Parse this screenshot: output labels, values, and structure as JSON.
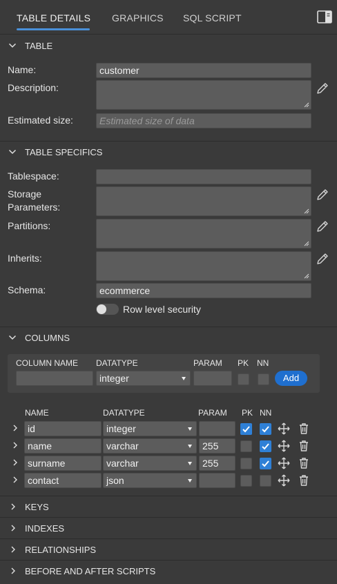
{
  "tabs": [
    {
      "label": "TABLE DETAILS",
      "active": true
    },
    {
      "label": "GRAPHICS",
      "active": false
    },
    {
      "label": "SQL SCRIPT",
      "active": false
    }
  ],
  "sections": {
    "table": "TABLE",
    "specifics": "TABLE SPECIFICS",
    "columns": "COLUMNS"
  },
  "table": {
    "name_label": "Name:",
    "name_value": "customer",
    "description_label": "Description:",
    "description_value": "",
    "size_label": "Estimated size:",
    "size_placeholder": "Estimated size of data"
  },
  "specifics": {
    "tablespace_label": "Tablespace:",
    "storage_label_1": "Storage",
    "storage_label_2": "Parameters:",
    "partitions_label": "Partitions:",
    "inherits_label": "Inherits:",
    "schema_label": "Schema:",
    "schema_value": "ecommerce",
    "rls_label": "Row level security",
    "rls_on": false
  },
  "new_column": {
    "headers": [
      "COLUMN NAME",
      "DATATYPE",
      "PARAM",
      "PK",
      "NN"
    ],
    "name": "",
    "datatype": "integer",
    "param": "",
    "add_label": "Add"
  },
  "columns": {
    "headers": [
      "NAME",
      "DATATYPE",
      "PARAM",
      "PK",
      "NN"
    ],
    "rows": [
      {
        "name": "id",
        "datatype": "integer",
        "param": "",
        "pk": true,
        "nn": true
      },
      {
        "name": "name",
        "datatype": "varchar",
        "param": "255",
        "pk": false,
        "nn": true
      },
      {
        "name": "surname",
        "datatype": "varchar",
        "param": "255",
        "pk": false,
        "nn": true
      },
      {
        "name": "contact",
        "datatype": "json",
        "param": "",
        "pk": false,
        "nn": false
      }
    ]
  },
  "collapsed_sections": [
    "KEYS",
    "INDEXES",
    "RELATIONSHIPS",
    "BEFORE AND AFTER SCRIPTS"
  ],
  "colors": {
    "background": "#3a3a3a",
    "field": "#5c5c5c",
    "accent": "#4a90d9",
    "checkbox_on": "#2f80d6",
    "button": "#1f6fcf"
  }
}
